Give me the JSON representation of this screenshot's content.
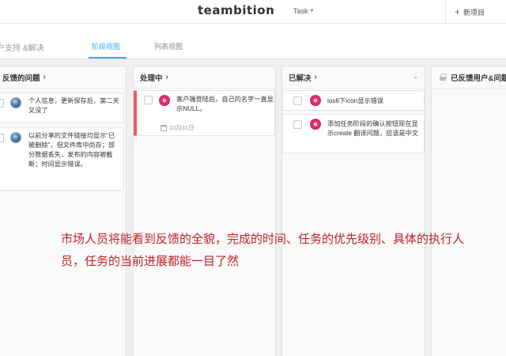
{
  "topbar": {
    "brand": "teambition",
    "task_menu": "Task",
    "new_project": "新项目"
  },
  "subnav": {
    "project_name": "户支持 &解决",
    "tabs": [
      {
        "label": "阶段视图",
        "active": true
      },
      {
        "label": "列表视图",
        "active": false
      }
    ]
  },
  "columns": [
    {
      "title": "反馈的问题",
      "arrow": "›",
      "cards": [
        {
          "text": "个人信息，更新保存后，第二天又没了",
          "avatar": "globe-avatar"
        },
        {
          "text": "以前分享的文件链接均显示“已被删除”，但文件库中尚存；部分数据丢失，发布的内容被截断；时间显示错误。",
          "avatar": "globe-avatar"
        }
      ]
    },
    {
      "title": "处理中",
      "arrow": "›",
      "cards": [
        {
          "text": "客户端登陆后，自己的名字一直显示NULL。",
          "avatar": "flower-avatar",
          "due": "10月31日",
          "urgent_color": "#ef5a5f"
        }
      ]
    },
    {
      "title": "已解决",
      "arrow": "›",
      "cards": [
        {
          "text": "ios6下icon显示错误",
          "avatar": "flower-avatar"
        },
        {
          "text": "添加任务阶段的确认按钮现在显示create 翻译问题，应该是中文",
          "avatar": "flower-avatar"
        }
      ]
    },
    {
      "title": "已反馈用户&问题",
      "arrow": "",
      "cards": []
    }
  ],
  "annotation": "市场人员将能看到反馈的全貌，完成的时间、任务的优先级别、具体的执行人员，任务的当前进展都能一目了然",
  "colors": {
    "accent": "#3da8f5",
    "urgent": "#ef5a5f",
    "annotation": "#c0202a"
  }
}
